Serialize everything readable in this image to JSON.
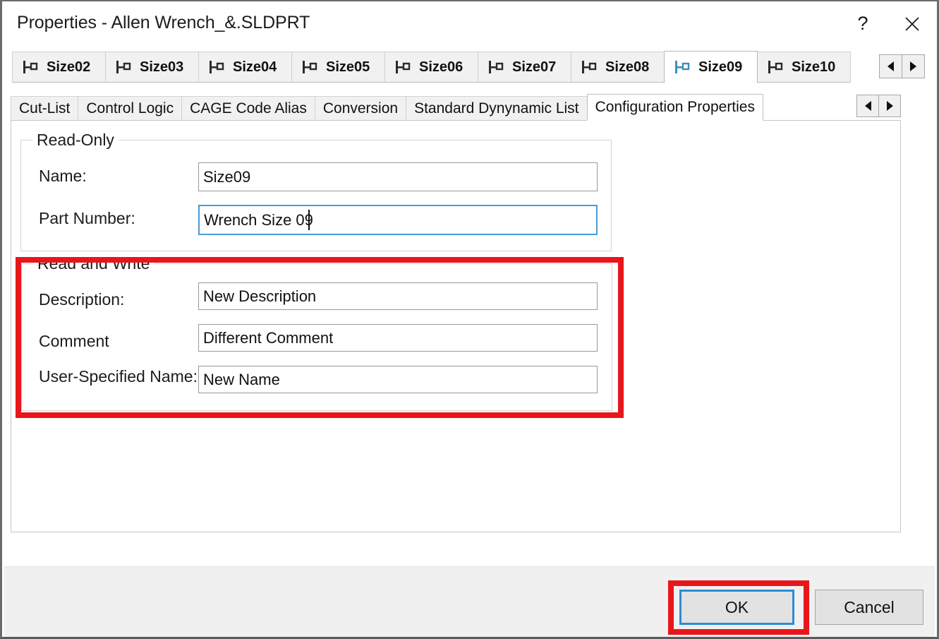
{
  "window": {
    "title": "Properties - Allen Wrench_&.SLDPRT",
    "help_glyph": "?",
    "close_icon": "close-icon"
  },
  "size_tabs": {
    "items": [
      {
        "label": "Size02",
        "icon": "configuration-icon",
        "active": false
      },
      {
        "label": "Size03",
        "icon": "configuration-icon",
        "active": false
      },
      {
        "label": "Size04",
        "icon": "configuration-icon",
        "active": false
      },
      {
        "label": "Size05",
        "icon": "configuration-icon",
        "active": false
      },
      {
        "label": "Size06",
        "icon": "configuration-icon",
        "active": false
      },
      {
        "label": "Size07",
        "icon": "configuration-icon",
        "active": false
      },
      {
        "label": "Size08",
        "icon": "configuration-icon",
        "active": false
      },
      {
        "label": "Size09",
        "icon": "configuration-icon",
        "active": true
      },
      {
        "label": "Size10",
        "icon": "configuration-icon",
        "active": false
      }
    ],
    "scroll_left_icon": "triangle-left-icon",
    "scroll_right_icon": "triangle-right-icon"
  },
  "property_tabs": {
    "items": [
      {
        "label": "Cut-List",
        "active": false
      },
      {
        "label": "Control Logic",
        "active": false
      },
      {
        "label": "CAGE Code Alias",
        "active": false
      },
      {
        "label": "Conversion",
        "active": false
      },
      {
        "label": "Standard Dynynamic List",
        "active": false
      },
      {
        "label": "Configuration Properties",
        "active": true
      }
    ],
    "scroll_left_icon": "triangle-left-icon",
    "scroll_right_icon": "triangle-right-icon"
  },
  "read_only_group": {
    "legend": "Read-Only",
    "fields": [
      {
        "label": "Name:",
        "value": "Size09",
        "focused": false
      },
      {
        "label": "Part Number:",
        "value": "Wrench Size 09",
        "focused": true
      }
    ]
  },
  "read_write_group": {
    "legend": "Read and Write",
    "fields": [
      {
        "label": "Description:",
        "value": "New Description",
        "focused": false
      },
      {
        "label": "Comment",
        "value": "Different Comment",
        "focused": false
      },
      {
        "label": "User-Specified Name:",
        "value": "New Name",
        "focused": false
      }
    ]
  },
  "footer": {
    "ok_label": "OK",
    "cancel_label": "Cancel"
  },
  "annotations": {
    "highlight_color": "#e8161b",
    "focus_color": "#2e8bd4",
    "active_tab_icon_color": "#3f8dbd"
  }
}
